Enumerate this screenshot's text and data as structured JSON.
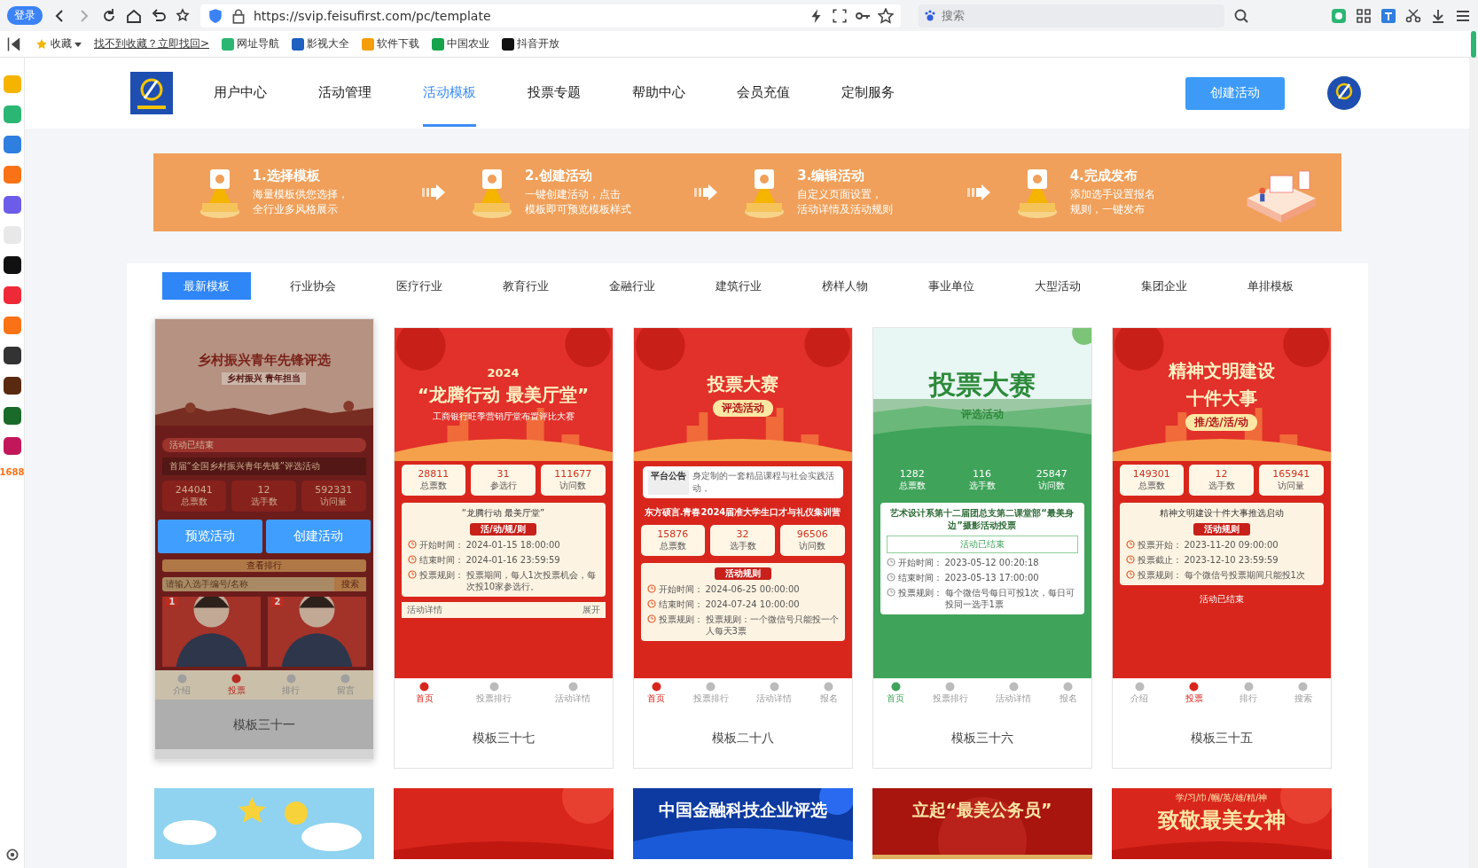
{
  "browser": {
    "login": "登录",
    "url": "https://svip.feisufirst.com/pc/template",
    "search_placeholder": "搜索"
  },
  "bookmarks": [
    {
      "label": "收藏",
      "kind": "menu"
    },
    {
      "label": "找不到收藏？立即找回>",
      "kind": "link"
    },
    {
      "label": "网址导航",
      "kind": "site"
    },
    {
      "label": "影视大全",
      "kind": "site"
    },
    {
      "label": "软件下载",
      "kind": "site"
    },
    {
      "label": "中国农业",
      "kind": "site"
    },
    {
      "label": "抖音开放",
      "kind": "site"
    }
  ],
  "sidebar": {
    "apps_label": "1688"
  },
  "header": {
    "nav": [
      {
        "label": "用户中心",
        "selected": false
      },
      {
        "label": "活动管理",
        "selected": false
      },
      {
        "label": "活动模板",
        "selected": true
      },
      {
        "label": "投票专题",
        "selected": false
      },
      {
        "label": "帮助中心",
        "selected": false
      },
      {
        "label": "会员充值",
        "selected": false
      },
      {
        "label": "定制服务",
        "selected": false
      }
    ],
    "create_button": "创建活动"
  },
  "steps": [
    {
      "title": "1.选择模板",
      "lines": [
        "海量模板供您选择，",
        "全行业多风格展示"
      ]
    },
    {
      "title": "2.创建活动",
      "lines": [
        "一键创建活动，点击",
        "模板即可预览模板样式"
      ]
    },
    {
      "title": "3.编辑活动",
      "lines": [
        "自定义页面设置，",
        "活动详情及活动规则"
      ]
    },
    {
      "title": "4.完成发布",
      "lines": [
        "添加选手设置报名",
        "规则，一键发布"
      ]
    }
  ],
  "categories": [
    {
      "label": "最新模板",
      "selected": true
    },
    {
      "label": "行业协会",
      "selected": false
    },
    {
      "label": "医疗行业",
      "selected": false
    },
    {
      "label": "教育行业",
      "selected": false
    },
    {
      "label": "金融行业",
      "selected": false
    },
    {
      "label": "建筑行业",
      "selected": false
    },
    {
      "label": "榜样人物",
      "selected": false
    },
    {
      "label": "事业单位",
      "selected": false
    },
    {
      "label": "大型活动",
      "selected": false
    },
    {
      "label": "集团企业",
      "selected": false
    },
    {
      "label": "单排模板",
      "selected": false
    }
  ],
  "templates": [
    {
      "name": "模板三十一",
      "kind": "crimson",
      "hovered": true,
      "actions": [
        "预览活动",
        "创建活动"
      ],
      "blocks": [
        {
          "kind": "hero",
          "lines": [
            {
              "kind": "title",
              "text": "乡村振兴青年先锋评选"
            },
            {
              "kind": "subtitle",
              "text": "乡村振兴 青年担当"
            }
          ]
        },
        {
          "kind": "status",
          "text": "活动已结束"
        },
        {
          "kind": "heading",
          "text": "首届“全国乡村振兴青年先锋”评选活动"
        },
        {
          "kind": "stats",
          "items": [
            {
              "value": "244041",
              "label": "总票数"
            },
            {
              "value": "12",
              "label": "选手数"
            },
            {
              "value": "592331",
              "label": "访问量"
            }
          ]
        },
        {
          "kind": "button",
          "text": "查看排行"
        },
        {
          "kind": "search",
          "placeholder": "请输入选手编号/名称",
          "button": "搜索"
        },
        {
          "kind": "candidates",
          "numbers": [
            "1",
            "2"
          ]
        },
        {
          "kind": "nav",
          "items": [
            {
              "label": "介绍",
              "selected": false
            },
            {
              "label": "投票",
              "selected": true
            },
            {
              "label": "排行",
              "selected": false
            },
            {
              "label": "留言",
              "selected": false
            }
          ]
        }
      ]
    },
    {
      "name": "模板三十七",
      "kind": "red",
      "hovered": false,
      "blocks": [
        {
          "kind": "hero",
          "lines": [
            {
              "kind": "year",
              "text": "2024"
            },
            {
              "kind": "title",
              "text": "“龙腾行动 最美厅堂”"
            },
            {
              "kind": "subtitle",
              "text": "工商银行旺季营销厅堂布置评比大赛"
            }
          ]
        },
        {
          "kind": "stats",
          "items": [
            {
              "value": "28811",
              "label": "总票数"
            },
            {
              "value": "31",
              "label": "参选行"
            },
            {
              "value": "111677",
              "label": "访问数"
            }
          ]
        },
        {
          "kind": "rules",
          "heading": "“龙腾行动 最美厅堂”",
          "title": "活/动/规/则",
          "items": [
            {
              "label": "开始时间：",
              "value": "2024-01-15 18:00:00"
            },
            {
              "label": "结束时间：",
              "value": "2024-01-16 23:59:59"
            },
            {
              "label": "投票规则：",
              "value": "投票期间，每人1次投票机会，每次投10家参选行。"
            }
          ]
        },
        {
          "kind": "section",
          "title": "活动详情",
          "action": "展开"
        },
        {
          "kind": "nav",
          "items": [
            {
              "label": "首页",
              "selected": true
            },
            {
              "label": "投票排行",
              "selected": false
            },
            {
              "label": "活动详情",
              "selected": false
            }
          ]
        }
      ]
    },
    {
      "name": "模板二十八",
      "kind": "red",
      "hovered": false,
      "blocks": [
        {
          "kind": "hero",
          "lines": [
            {
              "kind": "title",
              "text": "投票大赛"
            },
            {
              "kind": "tag",
              "text": "评选活动"
            }
          ]
        },
        {
          "kind": "notice",
          "label": "平台公告",
          "text": "身定制的一套精品课程与社会实践活动，"
        },
        {
          "kind": "heading",
          "text": "东方硕言.青春2024届准大学生口才与礼仪集训营"
        },
        {
          "kind": "stats",
          "items": [
            {
              "value": "15876",
              "label": "总票数"
            },
            {
              "value": "32",
              "label": "选手数"
            },
            {
              "value": "96506",
              "label": "访问数"
            }
          ]
        },
        {
          "kind": "rules",
          "title": "活动规则",
          "items": [
            {
              "label": "开始时间：",
              "value": "2024-06-25 00:00:00"
            },
            {
              "label": "结束时间：",
              "value": "2024-07-24 10:00:00"
            },
            {
              "label": "投票规则：",
              "value": "投票规则：一个微信号只能投一个人每天3票"
            }
          ]
        },
        {
          "kind": "nav",
          "items": [
            {
              "label": "首页",
              "selected": true
            },
            {
              "label": "投票排行",
              "selected": false
            },
            {
              "label": "活动详情",
              "selected": false
            },
            {
              "label": "报名",
              "selected": false
            }
          ]
        }
      ]
    },
    {
      "name": "模板三十六",
      "kind": "green",
      "hovered": false,
      "blocks": [
        {
          "kind": "hero",
          "lines": [
            {
              "kind": "title",
              "text": "投票大赛"
            },
            {
              "kind": "subtitle",
              "text": "评选活动"
            }
          ]
        },
        {
          "kind": "stats",
          "items": [
            {
              "value": "1282",
              "label": "总票数"
            },
            {
              "value": "116",
              "label": "选手数"
            },
            {
              "value": "25847",
              "label": "访问数"
            }
          ]
        },
        {
          "kind": "rules",
          "heading": "艺术设计系第十二届团总支第二课堂部“最美身边”摄影活动投票",
          "status": "活动已结束",
          "items": [
            {
              "label": "开始时间：",
              "value": "2023-05-12 00:20:18"
            },
            {
              "label": "结束时间：",
              "value": "2023-05-13 17:00:00"
            },
            {
              "label": "投票规则：",
              "value": "每个微信号每日可投1次，每日可投同一选手1票"
            }
          ]
        },
        {
          "kind": "nav",
          "items": [
            {
              "label": "首页",
              "selected": true
            },
            {
              "label": "投票排行",
              "selected": false
            },
            {
              "label": "活动详情",
              "selected": false
            },
            {
              "label": "报名",
              "selected": false
            }
          ]
        }
      ]
    },
    {
      "name": "模板三十五",
      "kind": "red",
      "hovered": false,
      "blocks": [
        {
          "kind": "hero",
          "lines": [
            {
              "kind": "title",
              "text": "精神文明建设"
            },
            {
              "kind": "title",
              "text": "十件大事"
            },
            {
              "kind": "tag",
              "text": "推/选/活/动"
            }
          ]
        },
        {
          "kind": "stats",
          "items": [
            {
              "value": "149301",
              "label": "总票数"
            },
            {
              "value": "12",
              "label": "选手数"
            },
            {
              "value": "165941",
              "label": "访问量"
            }
          ]
        },
        {
          "kind": "rules",
          "heading": "精神文明建设十件大事推选启动",
          "title": "活动规则",
          "items": [
            {
              "label": "投票开始：",
              "value": "2023-11-20 09:00:00"
            },
            {
              "label": "投票截止：",
              "value": "2023-12-10 23:59:59"
            },
            {
              "label": "投票规则：",
              "value": "每个微信号投票期间只能投1次"
            }
          ]
        },
        {
          "kind": "status",
          "text": "活动已结束"
        },
        {
          "kind": "nav",
          "items": [
            {
              "label": "介绍",
              "selected": false
            },
            {
              "label": "投票",
              "selected": true
            },
            {
              "label": "排行",
              "selected": false
            },
            {
              "label": "搜索",
              "selected": false
            }
          ]
        }
      ]
    }
  ],
  "more_templates": [
    {
      "kind": "sky"
    },
    {
      "kind": "red"
    },
    {
      "kind": "blue",
      "lines": [
        "中国金融科技企业评选"
      ]
    },
    {
      "kind": "crimson",
      "lines": [
        "立起“最美公务员”"
      ]
    },
    {
      "kind": "red",
      "lines": [
        "学/习/巾/帼/英/雄/精/神",
        "致敬最美女神"
      ]
    }
  ]
}
